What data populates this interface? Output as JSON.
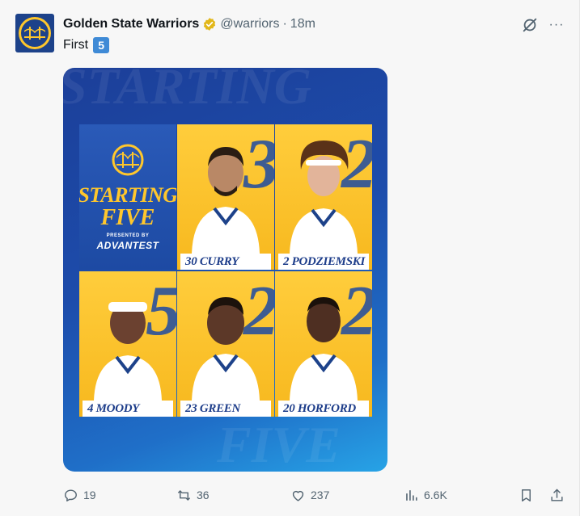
{
  "post": {
    "display_name": "Golden State Warriors",
    "handle": "@warriors",
    "separator": "·",
    "time": "18m",
    "text": "First",
    "keycap": "5",
    "more": "···"
  },
  "media": {
    "graphic_title_line1": "STARTING",
    "graphic_title_line2": "FIVE",
    "presented_by": "PRESENTED BY",
    "sponsor": "ADVANTEST",
    "players": [
      {
        "number": "30",
        "name": "CURRY",
        "label": "30 CURRY"
      },
      {
        "number": "2",
        "name": "PODZIEMSKI",
        "label": "2 PODZIEMSKI"
      },
      {
        "number": "4",
        "name": "MOODY",
        "label": "4 MOODY"
      },
      {
        "number": "23",
        "name": "GREEN",
        "label": "23 GREEN"
      },
      {
        "number": "20",
        "name": "HORFORD",
        "label": "20 HORFORD"
      }
    ],
    "colors": {
      "blue": "#1d428a",
      "gold": "#ffc72c"
    }
  },
  "actions": {
    "replies": "19",
    "reposts": "36",
    "likes": "237",
    "views": "6.6K"
  }
}
